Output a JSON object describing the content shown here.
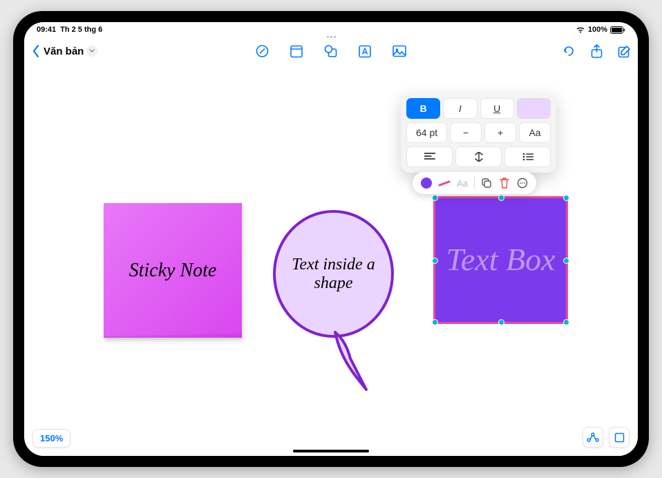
{
  "status": {
    "time": "09:41",
    "date": "Th 2 5 thg 6",
    "battery": "100%"
  },
  "header": {
    "doc_title": "Văn bản"
  },
  "canvas": {
    "sticky_note_text": "Sticky Note",
    "bubble_text": "Text inside a shape",
    "text_box_text": "Text Box"
  },
  "format": {
    "bold_label": "B",
    "italic_label": "I",
    "underline_label": "U",
    "font_size": "64 pt",
    "minus": "−",
    "plus": "+",
    "case_label": "Aa"
  },
  "context": {
    "text_label": "Aa"
  },
  "footer": {
    "zoom": "150%"
  }
}
